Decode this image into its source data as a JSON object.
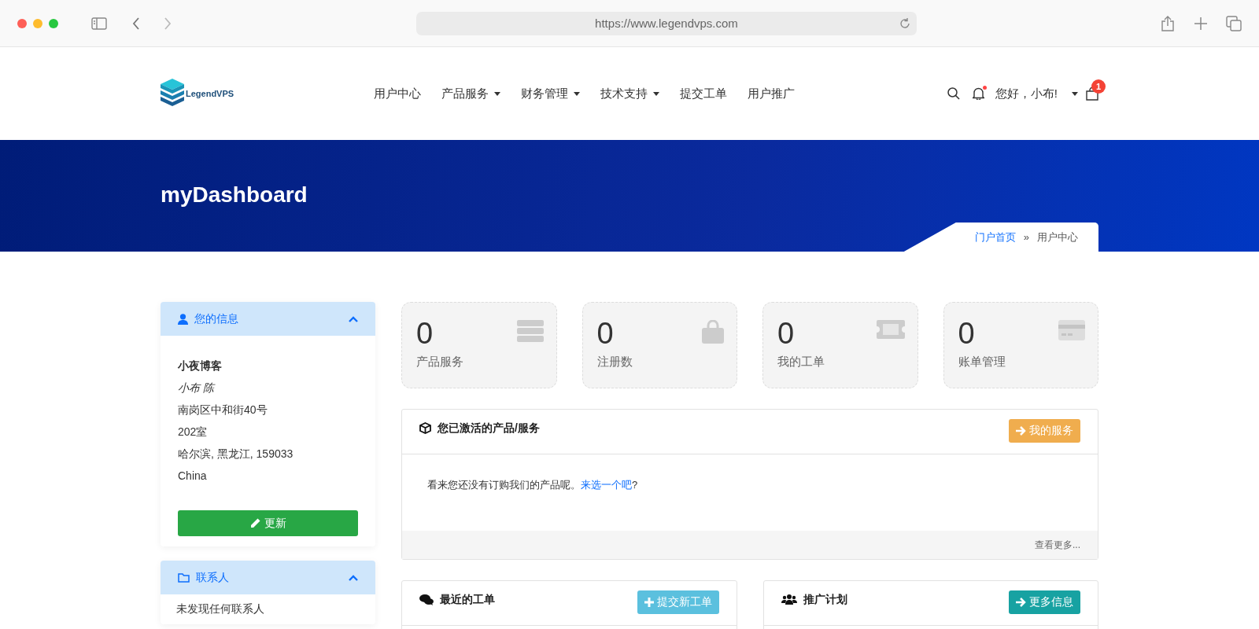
{
  "browser": {
    "url": "https://www.legendvps.com"
  },
  "header": {
    "logo_text": "LegendVPS",
    "nav": [
      {
        "label": "用户中心",
        "dropdown": false
      },
      {
        "label": "产品服务",
        "dropdown": true
      },
      {
        "label": "财务管理",
        "dropdown": true
      },
      {
        "label": "技术支持",
        "dropdown": true
      },
      {
        "label": "提交工单",
        "dropdown": false
      },
      {
        "label": "用户推广",
        "dropdown": false
      }
    ],
    "notification_unread": true,
    "greeting": "您好，小布!",
    "cart_count": "1"
  },
  "banner": {
    "title": "myDashboard",
    "breadcrumb": [
      {
        "label": "门户首页",
        "kind": "link"
      },
      {
        "label": "用户中心",
        "kind": "current"
      }
    ],
    "separator": "»"
  },
  "sidebar": [
    {
      "kind": "info",
      "title": "您的信息",
      "expanded": true,
      "company": "小夜博客",
      "contact": "小布 陈",
      "lines": [
        "南岗区中和街40号",
        "202室",
        "哈尔滨, 黑龙江, 159033",
        "China"
      ],
      "button": "更新"
    },
    {
      "kind": "contacts",
      "title": "联系人",
      "expanded": true,
      "empty_text": "未发现任何联系人"
    }
  ],
  "stats": [
    {
      "kind": "server",
      "value": "0",
      "label": "产品服务"
    },
    {
      "kind": "bag",
      "value": "0",
      "label": "注册数"
    },
    {
      "kind": "ticket",
      "value": "0",
      "label": "我的工单"
    },
    {
      "kind": "card",
      "value": "0",
      "label": "账单管理"
    }
  ],
  "panels": [
    {
      "kind": "products",
      "title": "您已激活的产品/服务",
      "button": "我的服务",
      "message": "看来您还没有订购我们的产品呢。",
      "link": "来选一个吧",
      "message_end": "?",
      "footer": "查看更多..."
    },
    {
      "kind": "tickets",
      "title": "最近的工单",
      "button": "提交新工单"
    },
    {
      "kind": "affiliates",
      "title": "推广计划",
      "button": "更多信息"
    }
  ]
}
